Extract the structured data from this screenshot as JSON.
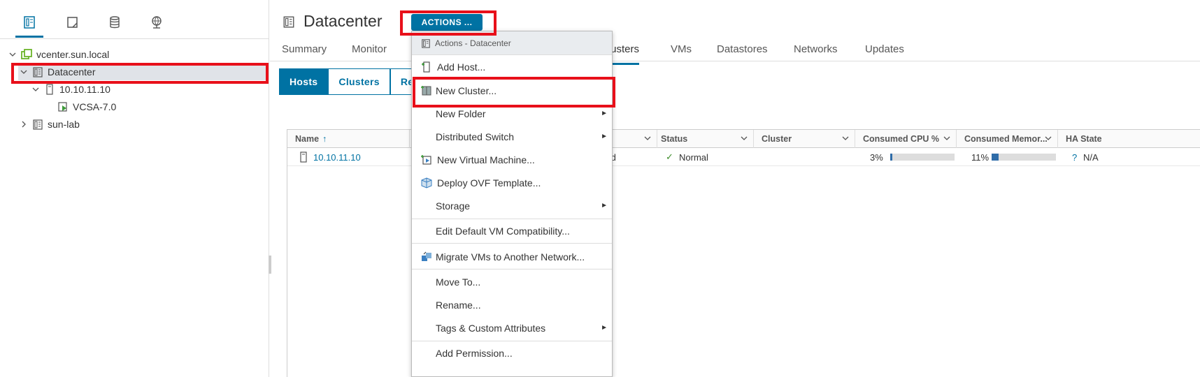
{
  "sidebar": {
    "tabs": [
      "hosts-clusters-icon",
      "vms-templates-icon",
      "storage-icon",
      "networking-icon"
    ],
    "tree": {
      "root": "vcenter.sun.local",
      "datacenter": "Datacenter",
      "host": "10.10.11.10",
      "vm": "VCSA-7.0",
      "other_dc": "sun-lab"
    }
  },
  "header": {
    "title": "Datacenter",
    "actions_label": "ACTIONS ..."
  },
  "tabs": [
    {
      "label": "Summary"
    },
    {
      "label": "Monitor"
    },
    {
      "label": "Clusters"
    },
    {
      "label": "VMs"
    },
    {
      "label": "Datastores"
    },
    {
      "label": "Networks"
    },
    {
      "label": "Updates"
    }
  ],
  "segments": [
    "Hosts",
    "Clusters",
    "Re"
  ],
  "grid": {
    "columns": [
      "Name",
      "Status",
      "Cluster",
      "Consumed CPU %",
      "Consumed Memor...",
      "HA State"
    ],
    "rows": [
      {
        "name": "10.10.11.10",
        "state_partial": "ected",
        "status": "Normal",
        "cluster": "",
        "cpu": "3%",
        "cpu_value": 3,
        "memory": "11%",
        "memory_value": 11,
        "ha_icon": "?",
        "ha_state": "N/A"
      }
    ]
  },
  "menu": {
    "header": "Actions - Datacenter",
    "items": [
      {
        "label": "Add Host...",
        "icon": "add-host-icon"
      },
      {
        "label": "New Cluster...",
        "icon": "new-cluster-icon"
      },
      {
        "label": "New Folder",
        "submenu": "►"
      },
      {
        "label": "Distributed Switch",
        "submenu": "►"
      },
      {
        "label": "New Virtual Machine...",
        "icon": "new-vm-icon"
      },
      {
        "label": "Deploy OVF Template...",
        "icon": "ovf-icon"
      },
      {
        "label": "Storage",
        "submenu": "►"
      },
      {
        "label": "Edit Default VM Compatibility..."
      },
      {
        "label": "Migrate VMs to Another Network...",
        "icon": "migrate-icon"
      },
      {
        "label": "Move To..."
      },
      {
        "label": "Rename..."
      },
      {
        "label": "Tags & Custom Attributes",
        "submenu": "►"
      },
      {
        "label": "Add Permission..."
      }
    ]
  },
  "colors": {
    "accent": "#0072a3",
    "highlight": "#e8101a",
    "bar_fill": "#2f6ca8"
  }
}
